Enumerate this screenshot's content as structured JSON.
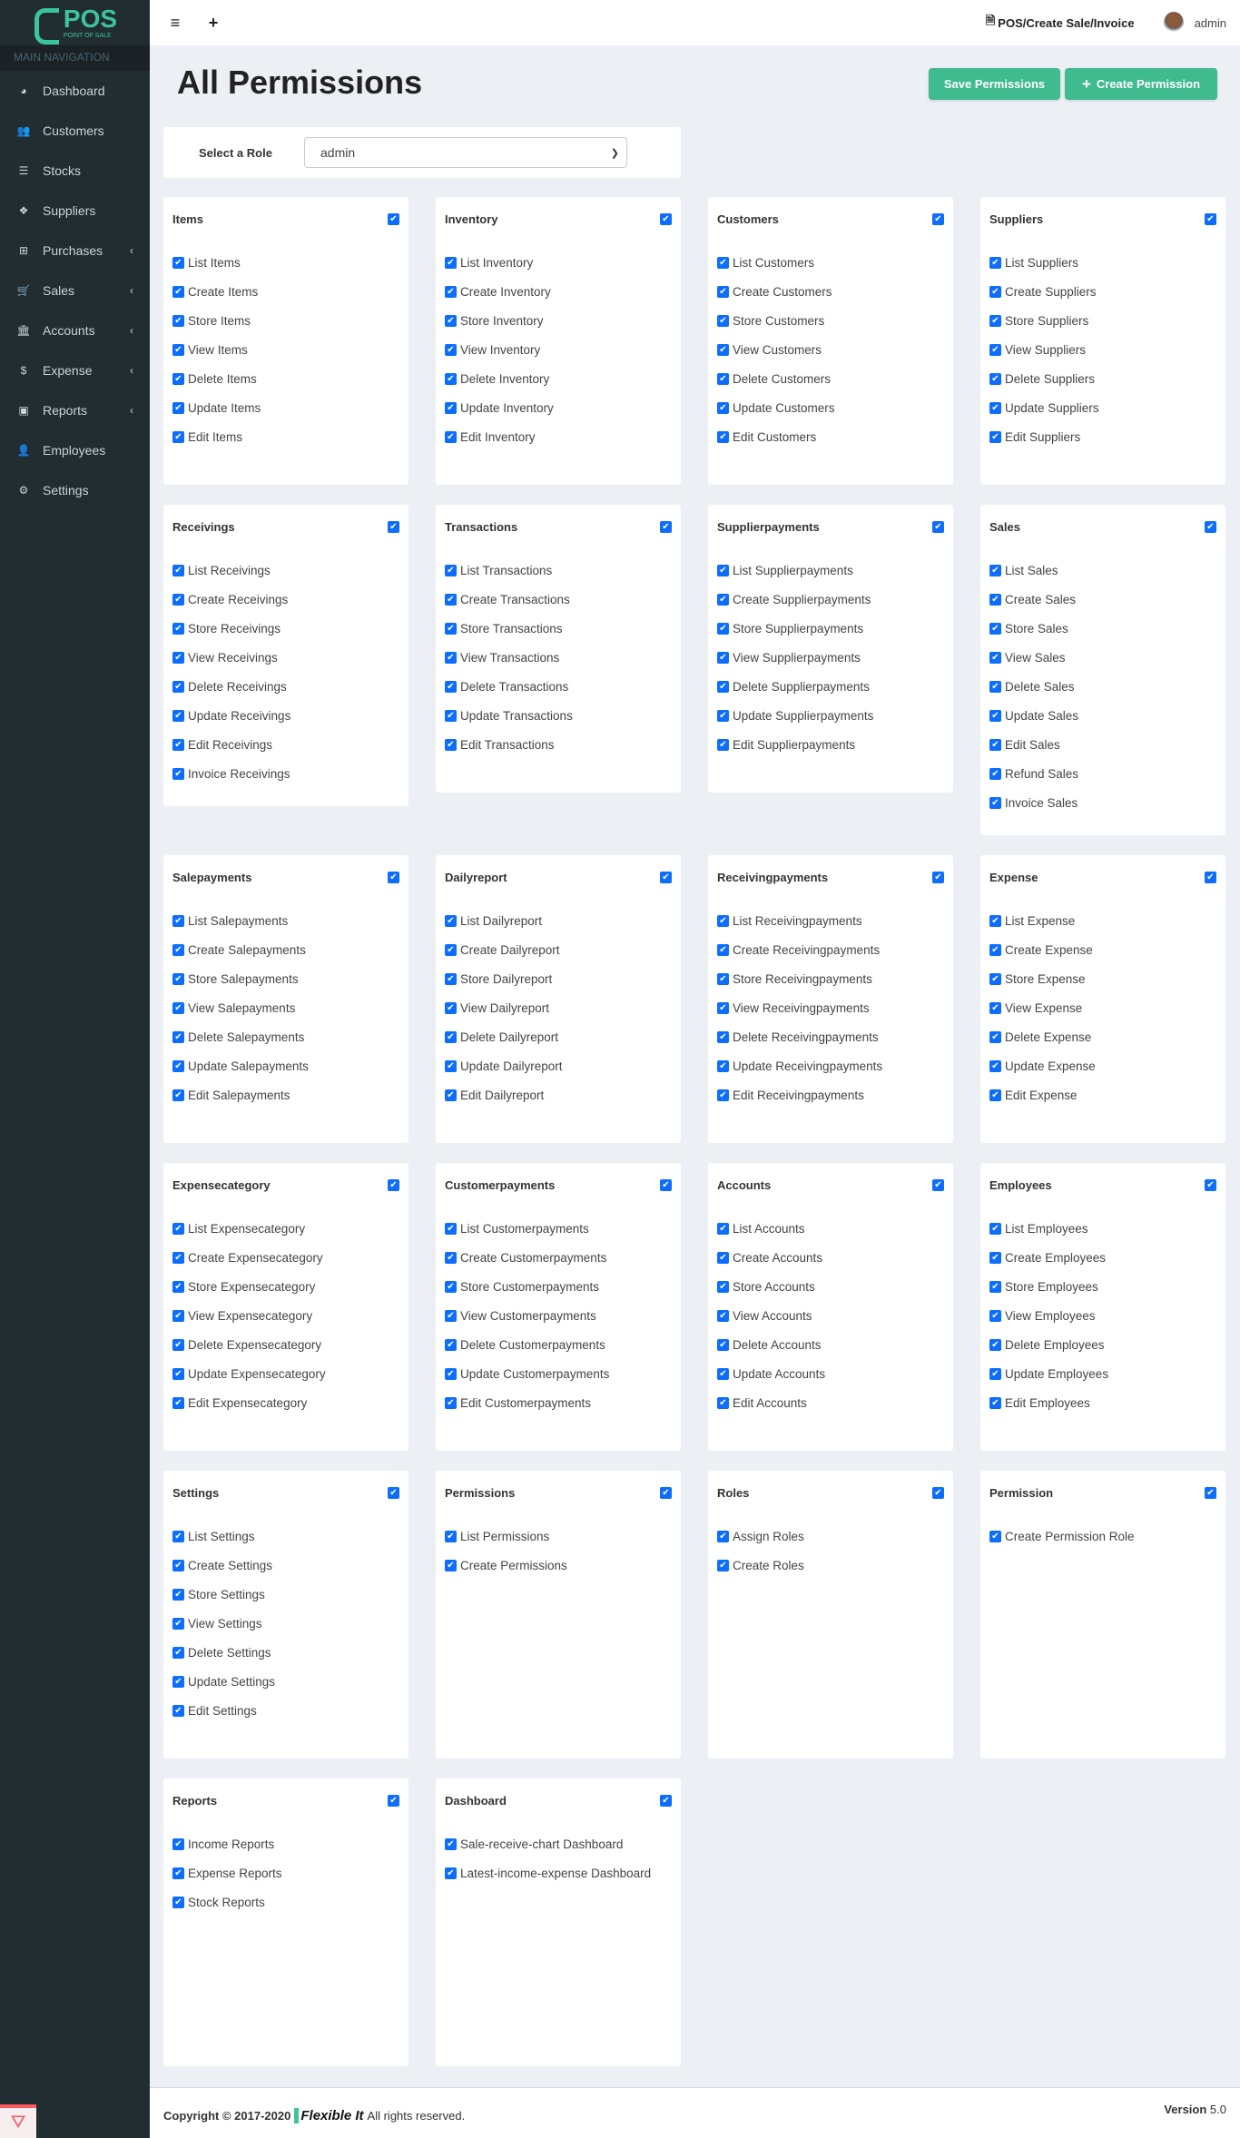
{
  "brand": {
    "name": "POS",
    "subtitle": "POINT OF SALE"
  },
  "sidebar": {
    "heading": "MAIN NAVIGATION",
    "items": [
      {
        "label": "Dashboard",
        "icon": "dashboard-icon",
        "glyph": "◕",
        "sub": false
      },
      {
        "label": "Customers",
        "icon": "users-icon",
        "glyph": "👥",
        "sub": false
      },
      {
        "label": "Stocks",
        "icon": "list-icon",
        "glyph": "☰",
        "sub": false
      },
      {
        "label": "Suppliers",
        "icon": "cubes-icon",
        "glyph": "❖",
        "sub": false
      },
      {
        "label": "Purchases",
        "icon": "sitemap-icon",
        "glyph": "⊞",
        "sub": true
      },
      {
        "label": "Sales",
        "icon": "cart-icon",
        "glyph": "🛒",
        "sub": true
      },
      {
        "label": "Accounts",
        "icon": "bank-icon",
        "glyph": "🏛",
        "sub": true
      },
      {
        "label": "Expense",
        "icon": "dollar-icon",
        "glyph": "$",
        "sub": true
      },
      {
        "label": "Reports",
        "icon": "money-icon",
        "glyph": "▣",
        "sub": true
      },
      {
        "label": "Employees",
        "icon": "user-icon",
        "glyph": "👤",
        "sub": false
      },
      {
        "label": "Settings",
        "icon": "gear-icon",
        "glyph": "⚙",
        "sub": false
      }
    ]
  },
  "topbar": {
    "pos_link": "POS/Create Sale/Invoice",
    "user": "admin"
  },
  "page": {
    "title": "All Permissions",
    "save_label": "Save Permissions",
    "create_label": "Create Permission",
    "role_label": "Select a Role",
    "role_value": "admin"
  },
  "accent": {
    "button": "#40ba8f",
    "checkbox": "#0d6efd",
    "sidebar": "#222d32"
  },
  "groups": [
    {
      "title": "Items",
      "items": [
        "List Items",
        "Create Items",
        "Store Items",
        "View Items",
        "Delete Items",
        "Update Items",
        "Edit Items"
      ]
    },
    {
      "title": "Inventory",
      "items": [
        "List Inventory",
        "Create Inventory",
        "Store Inventory",
        "View Inventory",
        "Delete Inventory",
        "Update Inventory",
        "Edit Inventory"
      ]
    },
    {
      "title": "Customers",
      "items": [
        "List Customers",
        "Create Customers",
        "Store Customers",
        "View Customers",
        "Delete Customers",
        "Update Customers",
        "Edit Customers"
      ]
    },
    {
      "title": "Suppliers",
      "items": [
        "List Suppliers",
        "Create Suppliers",
        "Store Suppliers",
        "View Suppliers",
        "Delete Suppliers",
        "Update Suppliers",
        "Edit Suppliers"
      ]
    },
    {
      "title": "Receivings",
      "items": [
        "List Receivings",
        "Create Receivings",
        "Store Receivings",
        "View Receivings",
        "Delete Receivings",
        "Update Receivings",
        "Edit Receivings",
        "Invoice Receivings"
      ]
    },
    {
      "title": "Transactions",
      "items": [
        "List Transactions",
        "Create Transactions",
        "Store Transactions",
        "View Transactions",
        "Delete Transactions",
        "Update Transactions",
        "Edit Transactions"
      ]
    },
    {
      "title": "Supplierpayments",
      "items": [
        "List Supplierpayments",
        "Create Supplierpayments",
        "Store Supplierpayments",
        "View Supplierpayments",
        "Delete Supplierpayments",
        "Update Supplierpayments",
        "Edit Supplierpayments"
      ]
    },
    {
      "title": "Sales",
      "items": [
        "List Sales",
        "Create Sales",
        "Store Sales",
        "View Sales",
        "Delete Sales",
        "Update Sales",
        "Edit Sales",
        "Refund Sales",
        "Invoice Sales"
      ]
    },
    {
      "title": "Salepayments",
      "items": [
        "List Salepayments",
        "Create Salepayments",
        "Store Salepayments",
        "View Salepayments",
        "Delete Salepayments",
        "Update Salepayments",
        "Edit Salepayments"
      ]
    },
    {
      "title": "Dailyreport",
      "items": [
        "List Dailyreport",
        "Create Dailyreport",
        "Store Dailyreport",
        "View Dailyreport",
        "Delete Dailyreport",
        "Update Dailyreport",
        "Edit Dailyreport"
      ]
    },
    {
      "title": "Receivingpayments",
      "items": [
        "List Receivingpayments",
        "Create Receivingpayments",
        "Store Receivingpayments",
        "View Receivingpayments",
        "Delete Receivingpayments",
        "Update Receivingpayments",
        "Edit Receivingpayments"
      ]
    },
    {
      "title": "Expense",
      "items": [
        "List Expense",
        "Create Expense",
        "Store Expense",
        "View Expense",
        "Delete Expense",
        "Update Expense",
        "Edit Expense"
      ]
    },
    {
      "title": "Expensecategory",
      "items": [
        "List Expensecategory",
        "Create Expensecategory",
        "Store Expensecategory",
        "View Expensecategory",
        "Delete Expensecategory",
        "Update Expensecategory",
        "Edit Expensecategory"
      ]
    },
    {
      "title": "Customerpayments",
      "items": [
        "List Customerpayments",
        "Create Customerpayments",
        "Store Customerpayments",
        "View Customerpayments",
        "Delete Customerpayments",
        "Update Customerpayments",
        "Edit Customerpayments"
      ]
    },
    {
      "title": "Accounts",
      "items": [
        "List Accounts",
        "Create Accounts",
        "Store Accounts",
        "View Accounts",
        "Delete Accounts",
        "Update Accounts",
        "Edit Accounts"
      ]
    },
    {
      "title": "Employees",
      "items": [
        "List Employees",
        "Create Employees",
        "Store Employees",
        "View Employees",
        "Delete Employees",
        "Update Employees",
        "Edit Employees"
      ]
    },
    {
      "title": "Settings",
      "items": [
        "List Settings",
        "Create Settings",
        "Store Settings",
        "View Settings",
        "Delete Settings",
        "Update Settings",
        "Edit Settings"
      ]
    },
    {
      "title": "Permissions",
      "items": [
        "List Permissions",
        "Create Permissions"
      ]
    },
    {
      "title": "Roles",
      "items": [
        "Assign Roles",
        "Create Roles"
      ]
    },
    {
      "title": "Permission",
      "items": [
        "Create Permission Role"
      ]
    },
    {
      "title": "Reports",
      "items": [
        "Income Reports",
        "Expense Reports",
        "Stock Reports"
      ]
    },
    {
      "title": "Dashboard",
      "items": [
        "Sale-receive-chart Dashboard",
        "Latest-income-expense Dashboard"
      ]
    }
  ],
  "footer": {
    "copyright": "Copyright © 2017-2020",
    "company": "Flexible It",
    "rights": "All rights reserved.",
    "version_label": "Version",
    "version": "5.0"
  }
}
